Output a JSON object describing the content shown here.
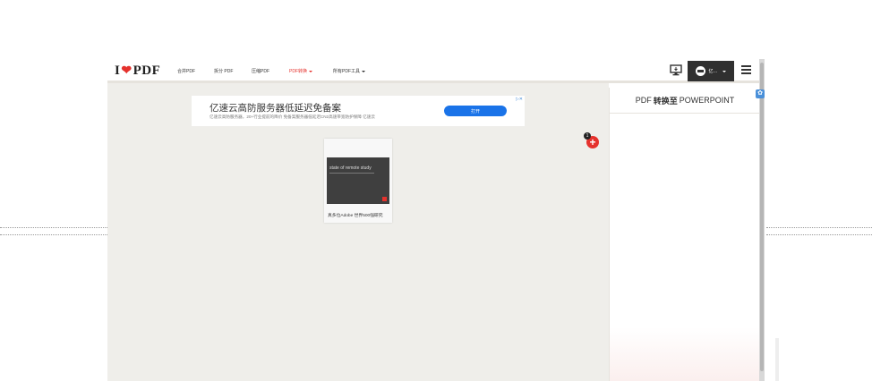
{
  "brand": {
    "logo_left": "I",
    "logo_right": "PDF",
    "accent": "#e5322d"
  },
  "nav": {
    "links": [
      {
        "label": "合并PDF"
      },
      {
        "label": "拆分 PDF"
      },
      {
        "label": "压缩PDF"
      },
      {
        "label": "PDF转换"
      },
      {
        "label": "所有PDF工具"
      }
    ],
    "active_index": 3
  },
  "user": {
    "name": "亿…"
  },
  "ad": {
    "title": "亿速云高防服务器低延迟免备案",
    "subtitle": "亿速云高防服务器，20+行业提前的降价 免备案服务器低延迟CN2高速带宽防护保障 亿速云",
    "button": "打开",
    "close": "▷✕"
  },
  "file": {
    "thumb_title": "state of remote study",
    "name": "真多位Adobe 世界500强研究"
  },
  "add_badge": "1",
  "add_symbol": "+",
  "sidebar": {
    "title_prefix": "PDF",
    "title_bold": "转换至",
    "title_suffix": "POWERPOINT"
  },
  "icons": {
    "desktop": "desktop-icon",
    "menu": "hamburger-menu-icon",
    "corner": "settings-badge-icon"
  }
}
